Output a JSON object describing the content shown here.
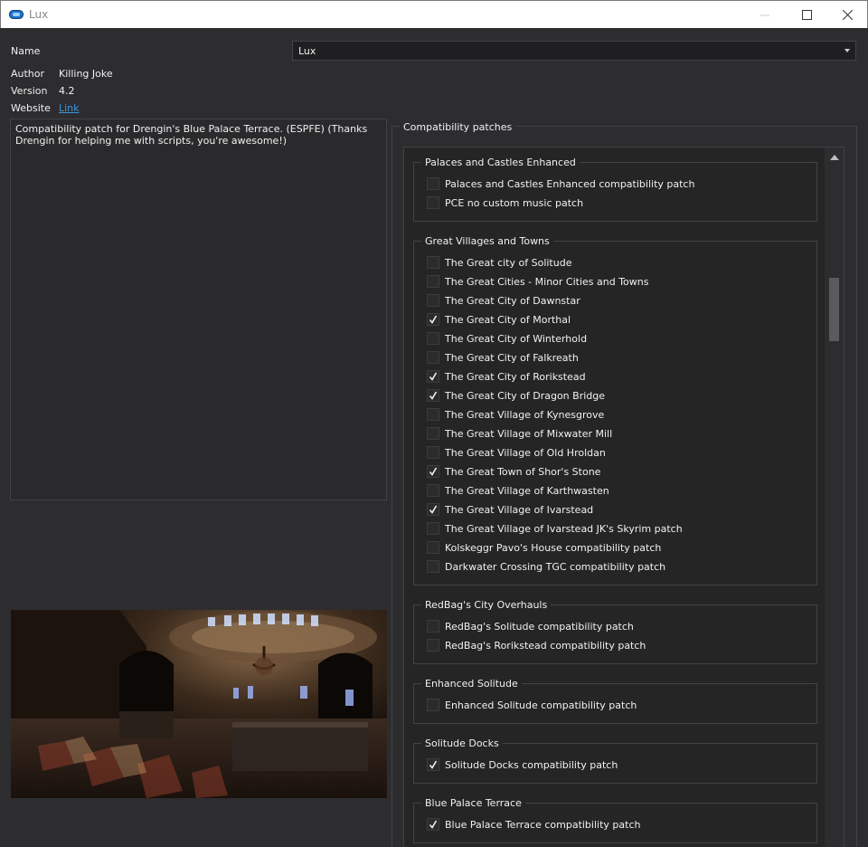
{
  "window": {
    "title": "Lux"
  },
  "fields": {
    "name_label": "Name",
    "name_value": "Lux",
    "author_label": "Author",
    "author_value": "Killing Joke",
    "version_label": "Version",
    "version_value": "4.2",
    "website_label": "Website",
    "website_link": "Link"
  },
  "description": "Compatibility patch for Drengin's Blue Palace Terrace. (ESPFE) (Thanks Drengin for helping me with scripts, you're awesome!)",
  "compat": {
    "title": "Compatibility patches",
    "groups": [
      {
        "title": "Palaces and Castles Enhanced",
        "options": [
          {
            "label": "Palaces and Castles Enhanced compatibility patch",
            "checked": false
          },
          {
            "label": "PCE no custom music patch",
            "checked": false
          }
        ]
      },
      {
        "title": "Great Villages and Towns",
        "options": [
          {
            "label": "The Great city of Solitude",
            "checked": false
          },
          {
            "label": "The Great Cities - Minor Cities and Towns",
            "checked": false
          },
          {
            "label": "The Great City of Dawnstar",
            "checked": false
          },
          {
            "label": "The Great City of Morthal",
            "checked": true
          },
          {
            "label": "The Great City of Winterhold",
            "checked": false
          },
          {
            "label": "The Great City of Falkreath",
            "checked": false
          },
          {
            "label": "The Great City of Rorikstead",
            "checked": true
          },
          {
            "label": "The Great City of Dragon Bridge",
            "checked": true
          },
          {
            "label": "The Great Village of Kynesgrove",
            "checked": false
          },
          {
            "label": "The Great Village of Mixwater Mill",
            "checked": false
          },
          {
            "label": "The Great Village of Old Hroldan",
            "checked": false
          },
          {
            "label": "The Great Town of Shor's Stone",
            "checked": true
          },
          {
            "label": "The Great Village of Karthwasten",
            "checked": false
          },
          {
            "label": "The Great Village of Ivarstead",
            "checked": true
          },
          {
            "label": "The Great Village of Ivarstead JK's Skyrim patch",
            "checked": false
          },
          {
            "label": "Kolskeggr Pavo's House compatibility patch",
            "checked": false
          },
          {
            "label": "Darkwater Crossing TGC compatibility patch",
            "checked": false
          }
        ]
      },
      {
        "title": "RedBag's City Overhauls",
        "options": [
          {
            "label": "RedBag's Solitude compatibility patch",
            "checked": false
          },
          {
            "label": "RedBag's Rorikstead compatibility patch",
            "checked": false
          }
        ]
      },
      {
        "title": "Enhanced Solitude",
        "options": [
          {
            "label": "Enhanced Solitude compatibility patch",
            "checked": false
          }
        ]
      },
      {
        "title": "Solitude Docks",
        "options": [
          {
            "label": "Solitude Docks compatibility patch",
            "checked": true
          }
        ]
      },
      {
        "title": "Blue Palace Terrace",
        "options": [
          {
            "label": "Blue Palace Terrace compatibility patch",
            "checked": true
          }
        ]
      }
    ]
  },
  "colors": {
    "background": "#2d2d30",
    "accent_link": "#3a96dd",
    "panel": "#252526"
  },
  "icons": {
    "app": "mod-organizer-icon",
    "minimize": "minimize-icon",
    "maximize": "maximize-icon",
    "close": "close-icon"
  }
}
